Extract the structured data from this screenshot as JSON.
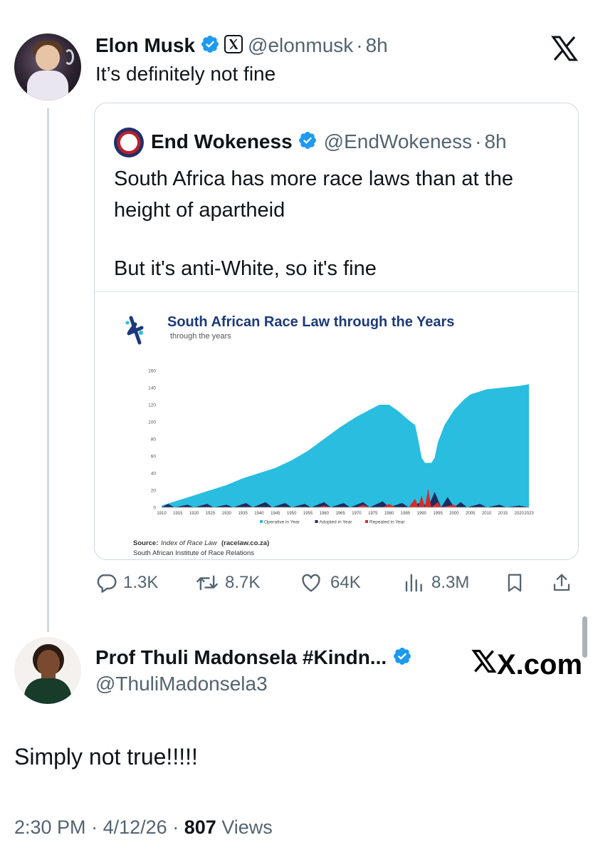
{
  "main_tweet": {
    "author_name": "Elon Musk",
    "handle": "@elonmusk",
    "time": "8h",
    "text": "It’s definitely not fine",
    "icons": [
      "verified-badge-icon",
      "x-affiliate-icon",
      "x-logo-icon"
    ]
  },
  "quoted_tweet": {
    "author_name": "End Wokeness",
    "handle": "@EndWokeness",
    "time": "8h",
    "text_line1": "South Africa has more race laws than at the",
    "text_line2": "height of apartheid",
    "text_line3": "But it's anti-White, so it's fine"
  },
  "chart_data": {
    "type": "area",
    "title": "South African Race Law through the Years",
    "subtitle": "through the years",
    "x_ticks": [
      "1910",
      "1915",
      "1920",
      "1925",
      "1930",
      "1935",
      "1940",
      "1945",
      "1950",
      "1955",
      "1960",
      "1965",
      "1970",
      "1975",
      "1980",
      "1985",
      "1990",
      "1995",
      "2000",
      "2005",
      "2010",
      "2015",
      "2020",
      "2023"
    ],
    "y_ticks": [
      "0",
      "20",
      "40",
      "60",
      "80",
      "100",
      "120",
      "140",
      "160"
    ],
    "ylim": [
      0,
      160
    ],
    "xlim": [
      1910,
      2023
    ],
    "legend": [
      "Operative in Year",
      "Adopted in Year",
      "Repealed in Year"
    ],
    "legend_placement": "bottom",
    "series": [
      {
        "name": "Operative in Year",
        "color": "#29bde0",
        "points": [
          [
            1910,
            2
          ],
          [
            1915,
            8
          ],
          [
            1920,
            14
          ],
          [
            1925,
            20
          ],
          [
            1930,
            26
          ],
          [
            1935,
            34
          ],
          [
            1940,
            40
          ],
          [
            1945,
            46
          ],
          [
            1950,
            55
          ],
          [
            1955,
            66
          ],
          [
            1960,
            80
          ],
          [
            1965,
            94
          ],
          [
            1970,
            106
          ],
          [
            1975,
            116
          ],
          [
            1977,
            120
          ],
          [
            1980,
            120
          ],
          [
            1983,
            112
          ],
          [
            1986,
            102
          ],
          [
            1988,
            96
          ],
          [
            1989,
            78
          ],
          [
            1990,
            58
          ],
          [
            1991,
            52
          ],
          [
            1993,
            52
          ],
          [
            1994,
            58
          ],
          [
            1995,
            76
          ],
          [
            1997,
            96
          ],
          [
            2000,
            114
          ],
          [
            2003,
            126
          ],
          [
            2005,
            132
          ],
          [
            2010,
            138
          ],
          [
            2015,
            140
          ],
          [
            2020,
            142
          ],
          [
            2023,
            144
          ]
        ]
      },
      {
        "name": "Adopted in Year",
        "color": "#1c2c5c",
        "points": [
          [
            1910,
            0
          ],
          [
            1912,
            4
          ],
          [
            1914,
            0
          ],
          [
            1918,
            3
          ],
          [
            1920,
            0
          ],
          [
            1924,
            4
          ],
          [
            1926,
            0
          ],
          [
            1930,
            3
          ],
          [
            1932,
            0
          ],
          [
            1936,
            5
          ],
          [
            1938,
            0
          ],
          [
            1942,
            6
          ],
          [
            1944,
            0
          ],
          [
            1948,
            5
          ],
          [
            1950,
            0
          ],
          [
            1954,
            4
          ],
          [
            1956,
            0
          ],
          [
            1960,
            6
          ],
          [
            1962,
            0
          ],
          [
            1966,
            5
          ],
          [
            1968,
            0
          ],
          [
            1972,
            6
          ],
          [
            1974,
            0
          ],
          [
            1978,
            7
          ],
          [
            1980,
            0
          ],
          [
            1984,
            5
          ],
          [
            1986,
            0
          ],
          [
            1990,
            6
          ],
          [
            1992,
            0
          ],
          [
            1994,
            18
          ],
          [
            1996,
            0
          ],
          [
            1998,
            12
          ],
          [
            2000,
            0
          ],
          [
            2002,
            6
          ],
          [
            2004,
            0
          ],
          [
            2008,
            4
          ],
          [
            2010,
            0
          ],
          [
            2014,
            3
          ],
          [
            2016,
            0
          ],
          [
            2020,
            2
          ],
          [
            2023,
            0
          ]
        ]
      },
      {
        "name": "Repealed in Year",
        "color": "#d62b2b",
        "points": [
          [
            1910,
            0
          ],
          [
            1958,
            0
          ],
          [
            1960,
            2
          ],
          [
            1962,
            0
          ],
          [
            1970,
            0
          ],
          [
            1972,
            3
          ],
          [
            1974,
            0
          ],
          [
            1978,
            0
          ],
          [
            1980,
            4
          ],
          [
            1982,
            0
          ],
          [
            1986,
            0
          ],
          [
            1988,
            10
          ],
          [
            1989,
            0
          ],
          [
            1990,
            14
          ],
          [
            1991,
            0
          ],
          [
            1992,
            22
          ],
          [
            1993,
            0
          ],
          [
            1995,
            6
          ],
          [
            1996,
            0
          ],
          [
            2000,
            3
          ],
          [
            2001,
            0
          ],
          [
            2023,
            0
          ]
        ]
      }
    ],
    "source_label": "Source:",
    "source_text": "Index of Race Law",
    "source_site": "(racelaw.co.za)",
    "source_org": "South African Institute of Race Relations"
  },
  "actions": {
    "replies": "1.3K",
    "reposts": "8.7K",
    "likes": "64K",
    "views": "8.3M"
  },
  "reply_tweet": {
    "author_name": "Prof Thuli Madonsela #Kindn...",
    "handle": "@ThuliMadonsela3",
    "text": "Simply not true!!!!!",
    "time": "2:30 PM",
    "date": "4/12/26",
    "views_count": "807",
    "views_label": "Views",
    "watermark": "X.com"
  },
  "colors": {
    "verified_blue": "#1d9bf0",
    "text_primary": "#0f1419",
    "text_secondary": "#536471",
    "border": "#cfd9de"
  }
}
